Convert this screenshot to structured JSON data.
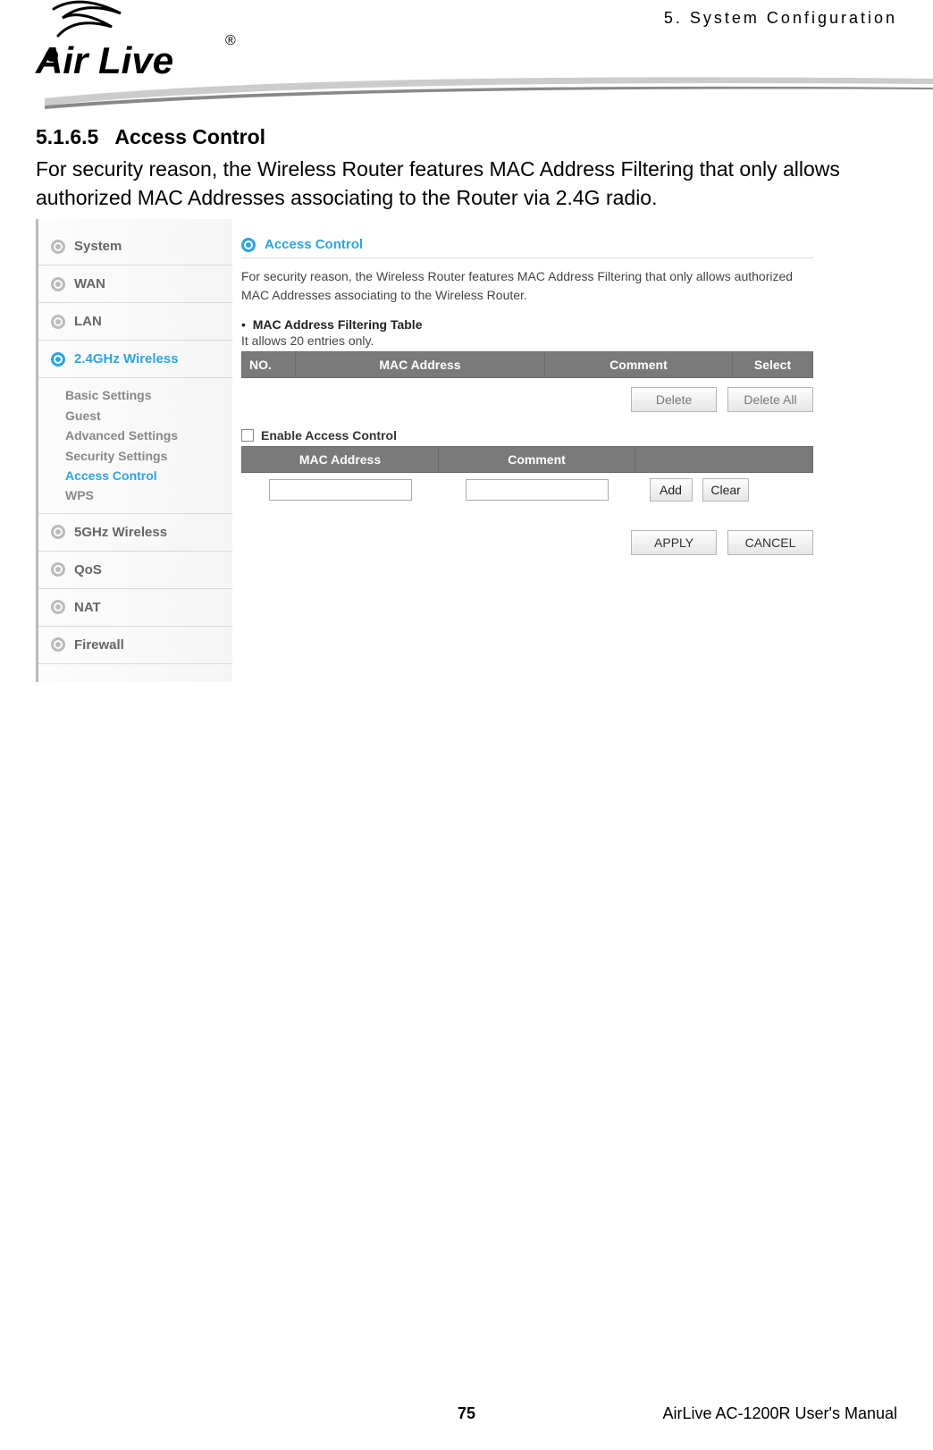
{
  "chapter": "5.  System  Configuration",
  "logo_text": "Air Live",
  "logo_reg": "®",
  "section": {
    "number": "5.1.6.5",
    "title": "Access Control",
    "body": "For security reason, the Wireless Router features MAC Address Filtering that only allows authorized MAC Addresses associating to the Router via 2.4G radio."
  },
  "sidebar": {
    "items": [
      {
        "label": "System",
        "active": false
      },
      {
        "label": "WAN",
        "active": false
      },
      {
        "label": "LAN",
        "active": false
      },
      {
        "label": "2.4GHz Wireless",
        "active": true
      },
      {
        "label": "5GHz Wireless",
        "active": false
      },
      {
        "label": "QoS",
        "active": false
      },
      {
        "label": "NAT",
        "active": false
      },
      {
        "label": "Firewall",
        "active": false
      }
    ],
    "submenu": [
      {
        "label": "Basic Settings",
        "active": false
      },
      {
        "label": "Guest",
        "active": false
      },
      {
        "label": "Advanced Settings",
        "active": false
      },
      {
        "label": "Security Settings",
        "active": false
      },
      {
        "label": "Access Control",
        "active": true
      },
      {
        "label": "WPS",
        "active": false
      }
    ]
  },
  "pane": {
    "title": "Access Control",
    "description": "For security reason, the Wireless Router features MAC Address Filtering that only allows authorized MAC Addresses associating to the Wireless Router.",
    "bullet": "MAC Address Filtering Table",
    "note": "It allows 20 entries only.",
    "table1_headers": {
      "no": "NO.",
      "mac": "MAC Address",
      "comment": "Comment",
      "select": "Select"
    },
    "delete_label": "Delete",
    "delete_all_label": "Delete All",
    "enable_label": "Enable Access Control",
    "table2_headers": {
      "mac": "MAC Address",
      "comment": "Comment"
    },
    "add_label": "Add",
    "clear_label": "Clear",
    "apply_label": "APPLY",
    "cancel_label": "CANCEL"
  },
  "footer": {
    "page": "75",
    "manual": "AirLive AC-1200R User's Manual"
  }
}
